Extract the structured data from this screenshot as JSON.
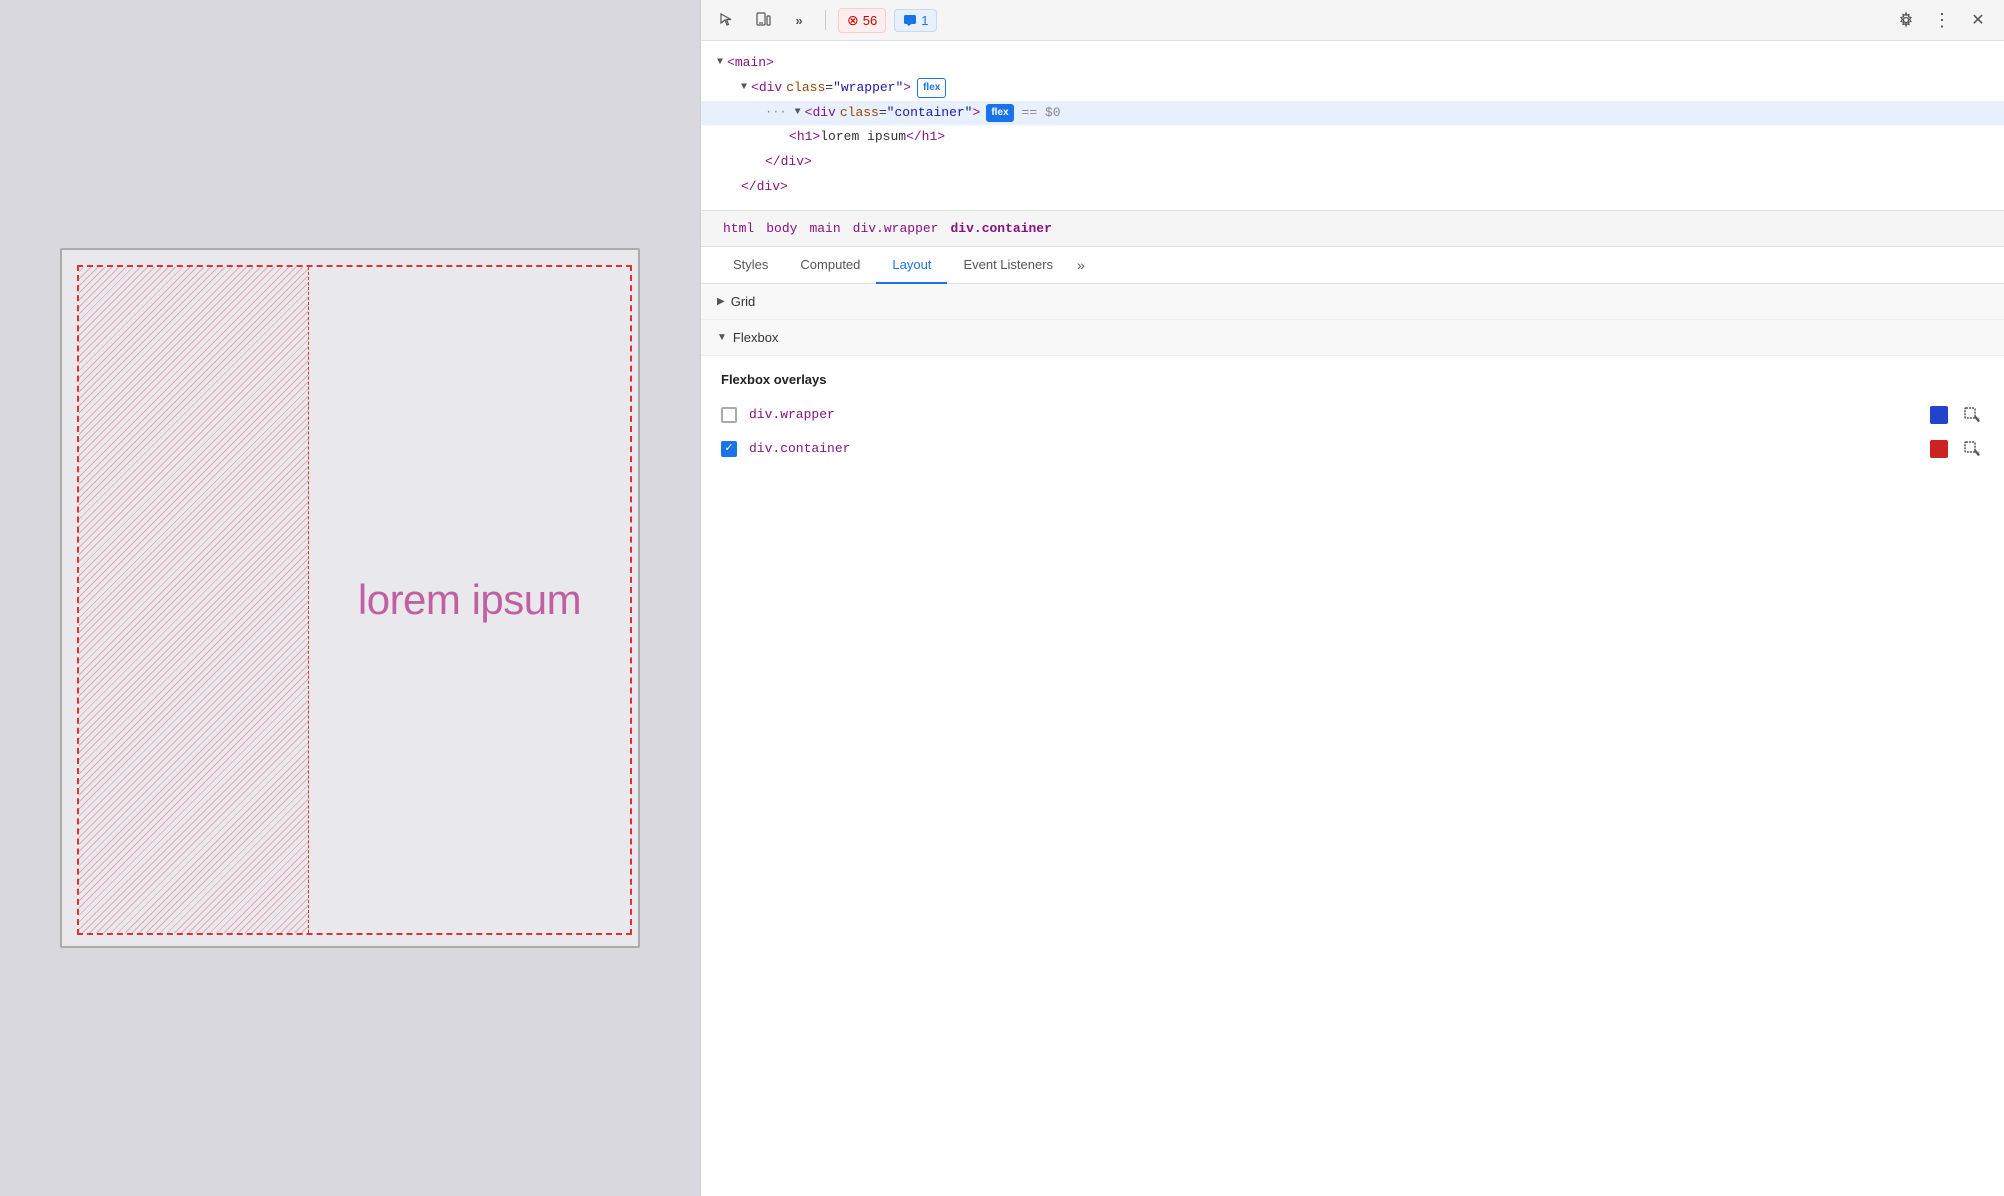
{
  "viewport": {
    "lorem_text": "lorem ipsum"
  },
  "devtools": {
    "toolbar": {
      "inspect_icon": "⬚",
      "device_icon": "📱",
      "more_icon": "»",
      "error_count": "56",
      "message_count": "1",
      "close_icon": "✕"
    },
    "html_tree": {
      "lines": [
        {
          "indent": 1,
          "content": "<main>",
          "tag": "main",
          "type": "open"
        },
        {
          "indent": 2,
          "content": "<div class=\"wrapper\">",
          "class": "wrapper",
          "badge": "flex",
          "badge_type": "outline"
        },
        {
          "indent": 3,
          "content": "<div class=\"container\">",
          "class": "container",
          "badge": "flex",
          "badge_type": "solid",
          "selected": true,
          "dollar": "== $0"
        },
        {
          "indent": 4,
          "content": "<h1>lorem ipsum</h1>",
          "tag": "h1",
          "text": "lorem ipsum"
        },
        {
          "indent": 3,
          "content": "</div>",
          "closing": true
        },
        {
          "indent": 2,
          "content": "</div>",
          "closing": true
        }
      ]
    },
    "breadcrumb": {
      "items": [
        "html",
        "body",
        "main",
        "div.wrapper",
        "div.container"
      ]
    },
    "tabs": {
      "items": [
        "Styles",
        "Computed",
        "Layout",
        "Event Listeners"
      ],
      "active": "Layout"
    },
    "layout": {
      "grid_section": "Grid",
      "flexbox_section": "Flexbox",
      "flexbox_overlays_title": "Flexbox overlays",
      "overlays": [
        {
          "id": "wrapper",
          "label": "div.wrapper",
          "checked": false,
          "color": "#2244cc"
        },
        {
          "id": "container",
          "label": "div.container",
          "checked": true,
          "color": "#cc2222"
        }
      ]
    }
  }
}
